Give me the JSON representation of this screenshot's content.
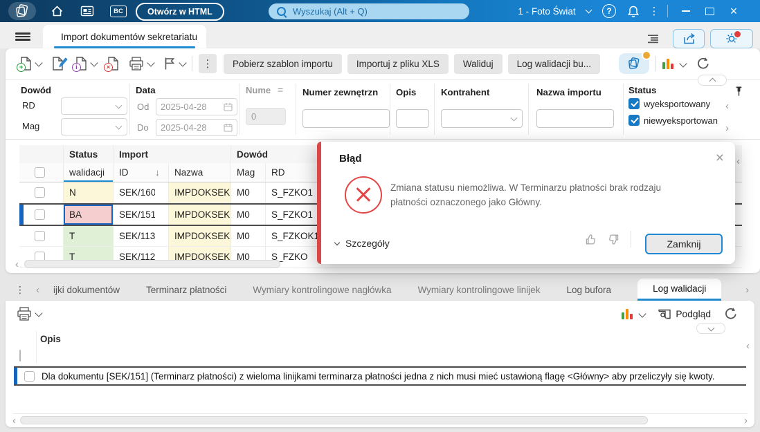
{
  "icons": {
    "kebab": "⋮",
    "chevron_left": "‹",
    "chevron_right": "›",
    "sort_desc": "↓",
    "close": "×",
    "question": "?",
    "bc": "BC",
    "equals": "="
  },
  "colors": {
    "accent": "#1779c4",
    "error": "#e24646",
    "status_new": "#fbf7d8",
    "status_error": "#f5cfcf",
    "status_ok": "#dff0d7",
    "badge_orange": "#eba834"
  },
  "topbar": {
    "open_html": "Otwórz w HTML",
    "search_placeholder": "Wyszukaj (Alt + Q)",
    "company": "1 - Foto Świat"
  },
  "tabbar": {
    "main_tab": "Import dokumentów sekretariatu"
  },
  "toolbar": {
    "buttons": [
      "Pobierz szablon importu",
      "Importuj z pliku XLS",
      "Waliduj",
      "Log walidacji bu..."
    ]
  },
  "filters": {
    "dowod": {
      "label": "Dowód",
      "rd": "RD",
      "mag": "Mag"
    },
    "data": {
      "label": "Data",
      "od": "Od",
      "od_value": "2025-04-28",
      "do": "Do",
      "do_value": "2025-04-28"
    },
    "numer": {
      "label": "Nume",
      "value": "0"
    },
    "numer_zewnetrzny": {
      "label": "Numer zewnętrzn"
    },
    "opis": {
      "label": "Opis"
    },
    "kontrahent": {
      "label": "Kontrahent"
    },
    "nazwa_importu": {
      "label": "Nazwa importu"
    },
    "status": {
      "label": "Status",
      "options": [
        "wyeksportowany",
        "niewyeksportowan"
      ]
    }
  },
  "grid": {
    "group_headers": [
      "Status",
      "Import",
      "Dowód"
    ],
    "columns": [
      "walidacji",
      "ID",
      "Nazwa",
      "Mag",
      "RD"
    ],
    "rows": [
      {
        "status": "N",
        "id": "SEK/160",
        "nazwa": "IMPDOKSEK",
        "mag": "M0",
        "rd": "S_FZKO1"
      },
      {
        "status": "BA",
        "id": "SEK/151",
        "nazwa": "IMPDOKSEK",
        "mag": "M0",
        "rd": "S_FZKO1"
      },
      {
        "status": "T",
        "id": "SEK/113",
        "nazwa": "IMPDOKSEK",
        "mag": "M0",
        "rd": "S_FZKOK1"
      },
      {
        "status": "T",
        "id": "SEK/112",
        "nazwa": "IMPDOKSEK",
        "mag": "M0",
        "rd": "S_FZKO"
      }
    ]
  },
  "dialog": {
    "title": "Błąd",
    "message": "Zmiana statusu niemożliwa. W Terminarzu płatności brak rodzaju płatności oznaczonego jako Główny.",
    "details": "Szczegóły",
    "close": "Zamknij"
  },
  "bottom": {
    "tabs": [
      "ijki dokumentów",
      "Terminarz płatności",
      "Wymiary kontrolingowe nagłówka",
      "Wymiary kontrolingowe linijek",
      "Log bufora",
      "Log walidacji"
    ],
    "preview": "Podgląd",
    "column_header": "Opis",
    "row_text": "Dla dokumentu [SEK/151] (Terminarz płatności) z wieloma linijkami terminarza płatności jedna z nich musi mieć ustawioną flagę <Główny> aby przeliczyły się kwoty."
  }
}
